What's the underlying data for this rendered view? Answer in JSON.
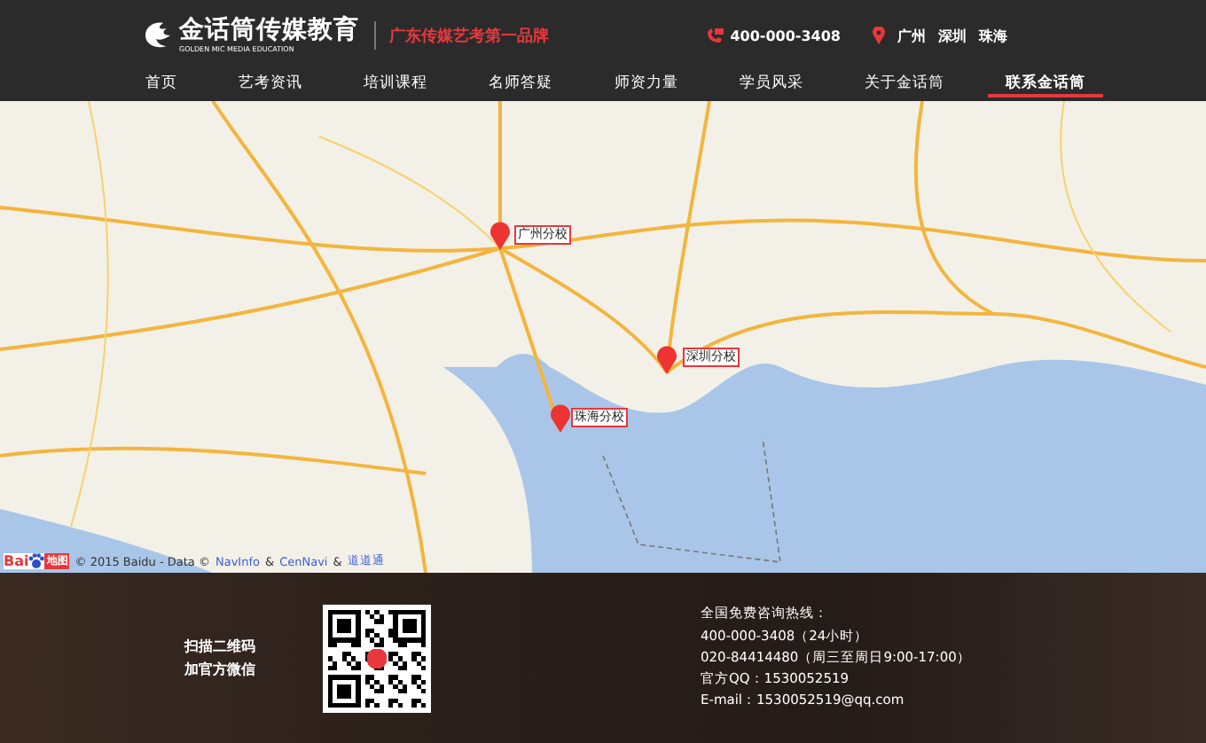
{
  "header": {
    "logo_text": "金话筒传媒教育",
    "logo_subtext": "GOLDEN MIC MEDIA EDUCATION",
    "slogan": "广东传媒艺考第一品牌",
    "phone": "400-000-3408",
    "cities": [
      "广州",
      "深圳",
      "珠海"
    ]
  },
  "nav": [
    {
      "label": "首页",
      "selected": false
    },
    {
      "label": "艺考资讯",
      "selected": false
    },
    {
      "label": "培训课程",
      "selected": false
    },
    {
      "label": "名师答疑",
      "selected": false
    },
    {
      "label": "师资力量",
      "selected": false
    },
    {
      "label": "学员风采",
      "selected": false
    },
    {
      "label": "关于金话筒",
      "selected": false
    },
    {
      "label": "联系金话筒",
      "selected": true
    }
  ],
  "map": {
    "markers": [
      {
        "label": "广州分校"
      },
      {
        "label": "深圳分校"
      },
      {
        "label": "珠海分校"
      }
    ],
    "logo": {
      "left": "Bai",
      "right": "地图"
    },
    "attribution": "© 2015 Baidu - Data ©",
    "providers": [
      "NavInfo",
      "CenNavi",
      "道道通"
    ],
    "separator": "&"
  },
  "footer": {
    "qr_caption": [
      "扫描二维码",
      "加官方微信"
    ],
    "contact": [
      "全国免费咨询热线：",
      "400-000-3408（24小时）",
      "020-84414480（周三至周日9:00-17:00）",
      "官方QQ：1530052519",
      "E-mail：1530052519@qq.com"
    ]
  }
}
